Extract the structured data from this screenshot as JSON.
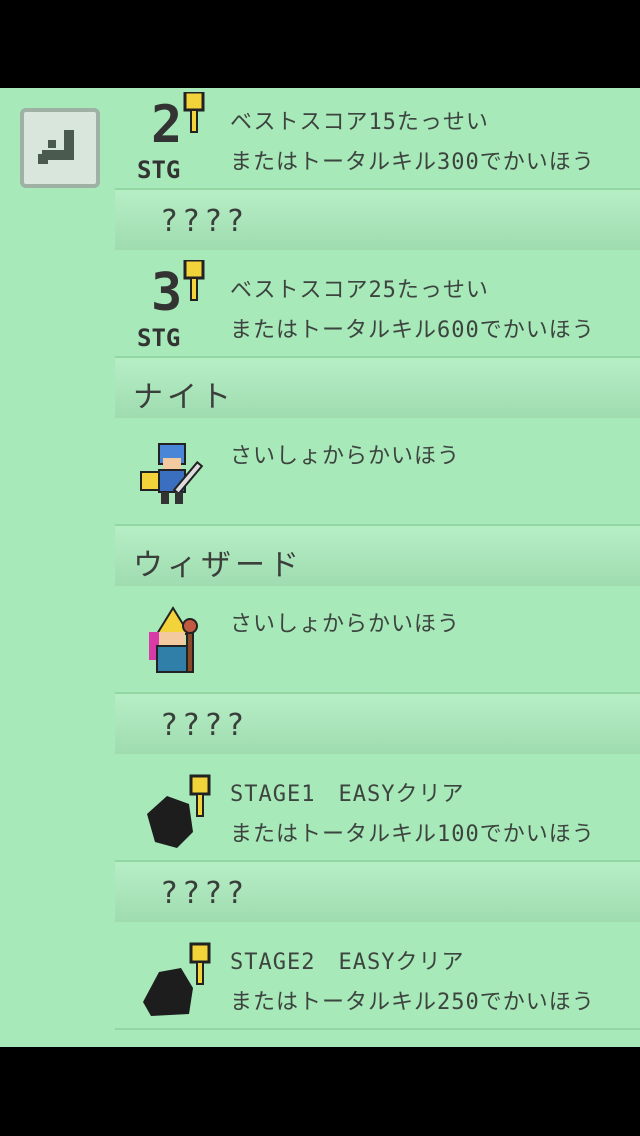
{
  "back_button": {
    "icon": "back-arrow-icon"
  },
  "entries": [
    {
      "title": "????",
      "icon": "stage-2-key-icon",
      "stage_num": "2",
      "stage_label": "STG",
      "line1": "ベストスコア15たっせい",
      "line2": "またはトータルキル300でかいほう"
    },
    {
      "title": "????",
      "icon": "stage-3-key-icon",
      "stage_num": "3",
      "stage_label": "STG",
      "line1": "ベストスコア25たっせい",
      "line2": "またはトータルキル600でかいほう"
    },
    {
      "title": "ナイト",
      "icon": "knight-icon",
      "line1": "さいしょからかいほう"
    },
    {
      "title": "ウィザード",
      "icon": "wizard-icon",
      "line1": "さいしょからかいほう"
    },
    {
      "title": "????",
      "icon": "locked-character-key-icon",
      "line1": "STAGE1　EASYクリア",
      "line2": "またはトータルキル100でかいほう"
    },
    {
      "title": "????",
      "icon": "locked-character-key-icon",
      "line1": "STAGE2　EASYクリア",
      "line2": "またはトータルキル250でかいほう"
    }
  ],
  "colors": {
    "background": "#a7e9b8",
    "text": "#3d4440",
    "key": "#f2d43a"
  }
}
